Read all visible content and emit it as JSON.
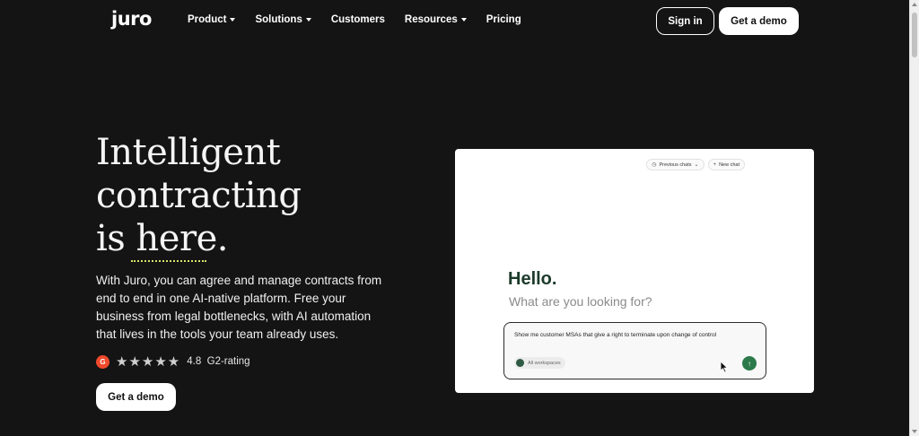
{
  "nav": {
    "logo": "juro",
    "links": [
      {
        "label": "Product",
        "dropdown": true
      },
      {
        "label": "Solutions",
        "dropdown": true
      },
      {
        "label": "Customers",
        "dropdown": false
      },
      {
        "label": "Resources",
        "dropdown": true
      },
      {
        "label": "Pricing",
        "dropdown": false
      }
    ],
    "sign_in": "Sign in",
    "get_demo": "Get a demo"
  },
  "hero": {
    "title_line1": "Intelligent",
    "title_line2": "contracting",
    "title_line3": "is here.",
    "description": "With Juro, you can agree and manage contracts from end to end in one AI-native platform. Free your business from legal bottlenecks, with AI automation that lives in the tools your team already uses.",
    "rating": {
      "badge": "G",
      "stars": 5,
      "stars_glyph": "★★★★★",
      "score": "4.8",
      "label": "G2-rating"
    },
    "cta": "Get a demo"
  },
  "card": {
    "previous_chats": "Previous chats",
    "new_chat": "New chat",
    "greeting": "Hello.",
    "subtitle": "What are you looking for?",
    "prompt": "Show me customer MSAs that give a right to terminate upon change of control",
    "workspace": "All workspaces"
  },
  "colors": {
    "background": "#141414",
    "accent_green": "#2c7a4b",
    "underline": "#d8e36a",
    "g2_red": "#ef4a2c"
  }
}
